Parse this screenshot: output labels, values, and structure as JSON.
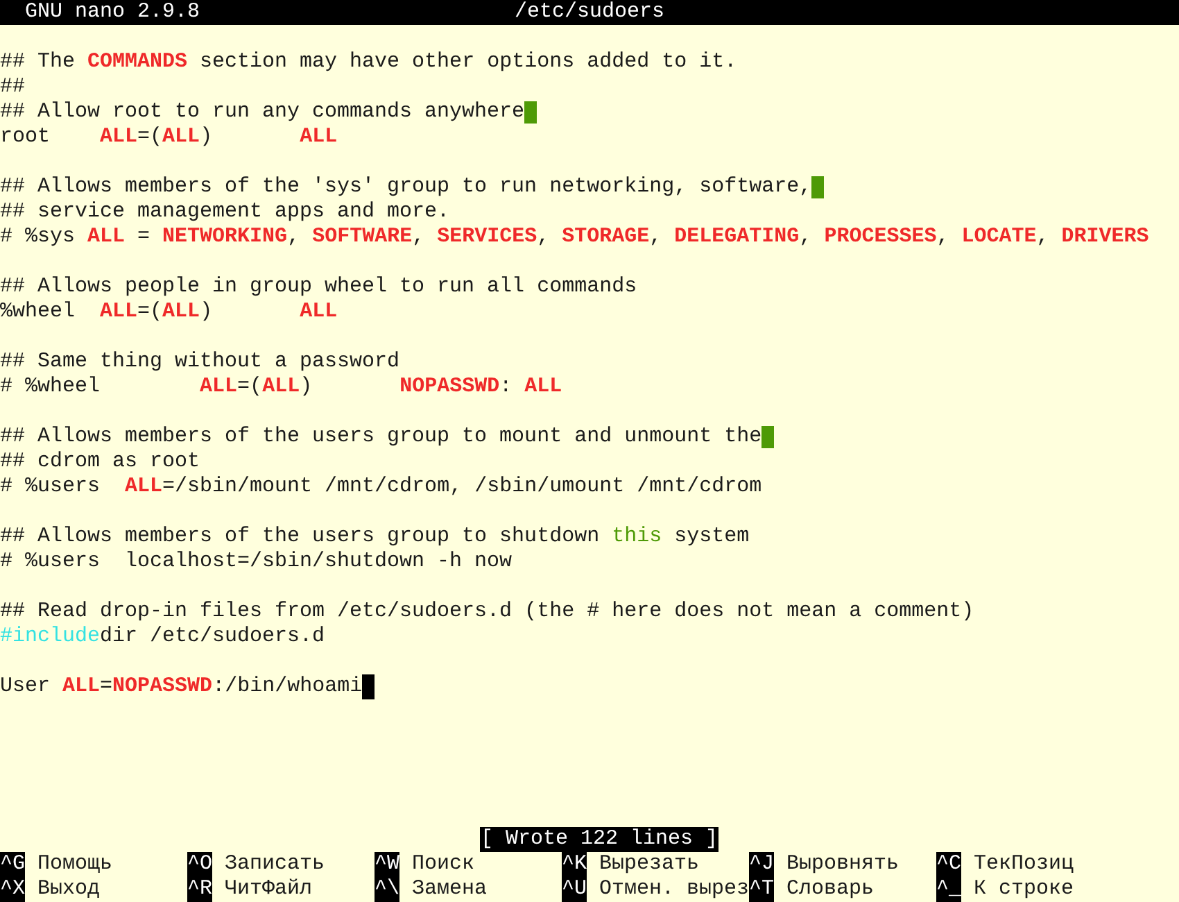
{
  "title_bar": {
    "app": "GNU nano 2.9.8",
    "file": "/etc/sudoers"
  },
  "lines": [
    {
      "segments": [
        {
          "kind": "plain",
          "text": "## The "
        },
        {
          "kind": "keyword",
          "text": "COMMANDS"
        },
        {
          "kind": "plain",
          "text": " section may have other options added to it."
        }
      ],
      "trailing_whitespace": false,
      "cursor": false
    },
    {
      "segments": [
        {
          "kind": "plain",
          "text": "##"
        }
      ],
      "trailing_whitespace": false,
      "cursor": false
    },
    {
      "segments": [
        {
          "kind": "plain",
          "text": "## Allow root to run any commands anywhere"
        }
      ],
      "trailing_whitespace": true,
      "cursor": false
    },
    {
      "segments": [
        {
          "kind": "plain",
          "text": "root    "
        },
        {
          "kind": "keyword",
          "text": "ALL"
        },
        {
          "kind": "plain",
          "text": "=("
        },
        {
          "kind": "keyword",
          "text": "ALL"
        },
        {
          "kind": "plain",
          "text": ")       "
        },
        {
          "kind": "keyword",
          "text": "ALL"
        }
      ],
      "trailing_whitespace": false,
      "cursor": false
    },
    {
      "trailing_whitespace": false,
      "cursor": false
    },
    {
      "segments": [
        {
          "kind": "plain",
          "text": "## Allows members of the 'sys' group to run networking, software,"
        }
      ],
      "trailing_whitespace": true,
      "cursor": false
    },
    {
      "segments": [
        {
          "kind": "plain",
          "text": "## service management apps and more."
        }
      ],
      "trailing_whitespace": false,
      "cursor": false
    },
    {
      "segments": [
        {
          "kind": "plain",
          "text": "# %sys "
        },
        {
          "kind": "keyword",
          "text": "ALL"
        },
        {
          "kind": "plain",
          "text": " = "
        },
        {
          "kind": "keyword",
          "text": "NETWORKING"
        },
        {
          "kind": "plain",
          "text": ", "
        },
        {
          "kind": "keyword",
          "text": "SOFTWARE"
        },
        {
          "kind": "plain",
          "text": ", "
        },
        {
          "kind": "keyword",
          "text": "SERVICES"
        },
        {
          "kind": "plain",
          "text": ", "
        },
        {
          "kind": "keyword",
          "text": "STORAGE"
        },
        {
          "kind": "plain",
          "text": ", "
        },
        {
          "kind": "keyword",
          "text": "DELEGATING"
        },
        {
          "kind": "plain",
          "text": ", "
        },
        {
          "kind": "keyword",
          "text": "PROCESSES"
        },
        {
          "kind": "plain",
          "text": ", "
        },
        {
          "kind": "keyword",
          "text": "LOCATE"
        },
        {
          "kind": "plain",
          "text": ", "
        },
        {
          "kind": "keyword",
          "text": "DRIVERS"
        }
      ],
      "trailing_whitespace": false,
      "cursor": false
    },
    {
      "trailing_whitespace": false,
      "cursor": false
    },
    {
      "segments": [
        {
          "kind": "plain",
          "text": "## Allows people in group wheel to run all commands"
        }
      ],
      "trailing_whitespace": false,
      "cursor": false
    },
    {
      "segments": [
        {
          "kind": "plain",
          "text": "%wheel  "
        },
        {
          "kind": "keyword",
          "text": "ALL"
        },
        {
          "kind": "plain",
          "text": "=("
        },
        {
          "kind": "keyword",
          "text": "ALL"
        },
        {
          "kind": "plain",
          "text": ")       "
        },
        {
          "kind": "keyword",
          "text": "ALL"
        }
      ],
      "trailing_whitespace": false,
      "cursor": false
    },
    {
      "trailing_whitespace": false,
      "cursor": false
    },
    {
      "segments": [
        {
          "kind": "plain",
          "text": "## Same thing without a password"
        }
      ],
      "trailing_whitespace": false,
      "cursor": false
    },
    {
      "segments": [
        {
          "kind": "plain",
          "text": "# %wheel        "
        },
        {
          "kind": "keyword",
          "text": "ALL"
        },
        {
          "kind": "plain",
          "text": "=("
        },
        {
          "kind": "keyword",
          "text": "ALL"
        },
        {
          "kind": "plain",
          "text": ")       "
        },
        {
          "kind": "keyword",
          "text": "NOPASSWD"
        },
        {
          "kind": "plain",
          "text": ": "
        },
        {
          "kind": "keyword",
          "text": "ALL"
        }
      ],
      "trailing_whitespace": false,
      "cursor": false
    },
    {
      "trailing_whitespace": false,
      "cursor": false
    },
    {
      "segments": [
        {
          "kind": "plain",
          "text": "## Allows members of the users group to mount and unmount the"
        }
      ],
      "trailing_whitespace": true,
      "cursor": false
    },
    {
      "segments": [
        {
          "kind": "plain",
          "text": "## cdrom as root"
        }
      ],
      "trailing_whitespace": false,
      "cursor": false
    },
    {
      "segments": [
        {
          "kind": "plain",
          "text": "# %users  "
        },
        {
          "kind": "keyword",
          "text": "ALL"
        },
        {
          "kind": "plain",
          "text": "=/sbin/mount /mnt/cdrom, /sbin/umount /mnt/cdrom"
        }
      ],
      "trailing_whitespace": false,
      "cursor": false
    },
    {
      "trailing_whitespace": false,
      "cursor": false
    },
    {
      "segments": [
        {
          "kind": "plain",
          "text": "## Allows members of the users group to shutdown "
        },
        {
          "kind": "highlight",
          "text": "this"
        },
        {
          "kind": "plain",
          "text": " system"
        }
      ],
      "trailing_whitespace": false,
      "cursor": false
    },
    {
      "segments": [
        {
          "kind": "plain",
          "text": "# %users  localhost=/sbin/shutdown -h now"
        }
      ],
      "trailing_whitespace": false,
      "cursor": false
    },
    {
      "trailing_whitespace": false,
      "cursor": false
    },
    {
      "segments": [
        {
          "kind": "plain",
          "text": "## Read drop-in files from /etc/sudoers.d (the # here does not mean a comment)"
        }
      ],
      "trailing_whitespace": false,
      "cursor": false
    },
    {
      "segments": [
        {
          "kind": "directive",
          "text": "#include"
        },
        {
          "kind": "plain",
          "text": "dir /etc/sudoers.d"
        }
      ],
      "trailing_whitespace": false,
      "cursor": false
    },
    {
      "trailing_whitespace": false,
      "cursor": false
    },
    {
      "segments": [
        {
          "kind": "plain",
          "text": "User "
        },
        {
          "kind": "keyword",
          "text": "ALL"
        },
        {
          "kind": "plain",
          "text": "="
        },
        {
          "kind": "keyword",
          "text": "NOPASSWD"
        },
        {
          "kind": "plain",
          "text": ":/bin/whoami"
        }
      ],
      "trailing_whitespace": false,
      "cursor": true
    }
  ],
  "status": "[ Wrote 122 lines ]",
  "shortcuts": [
    [
      {
        "key": "^G",
        "label": "Помощь"
      },
      {
        "key": "^O",
        "label": "Записать"
      },
      {
        "key": "^W",
        "label": "Поиск"
      },
      {
        "key": "^K",
        "label": "Вырезать"
      },
      {
        "key": "^J",
        "label": "Выровнять"
      },
      {
        "key": "^C",
        "label": "ТекПозиц"
      }
    ],
    [
      {
        "key": "^X",
        "label": "Выход"
      },
      {
        "key": "^R",
        "label": "ЧитФайл"
      },
      {
        "key": "^\\",
        "label": "Замена"
      },
      {
        "key": "^U",
        "label": "Отмен. вырез"
      },
      {
        "key": "^T",
        "label": "Словарь"
      },
      {
        "key": "^_",
        "label": "К строке"
      }
    ]
  ]
}
